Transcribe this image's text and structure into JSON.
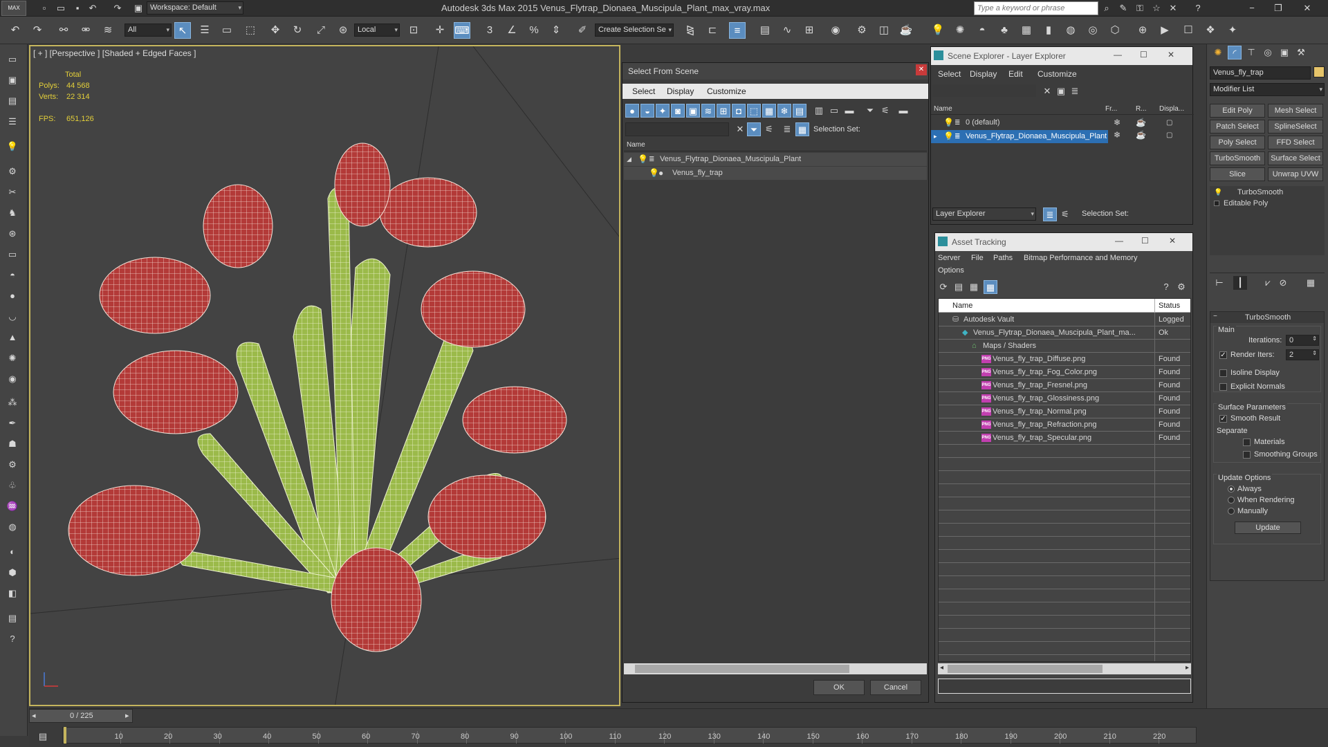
{
  "app": {
    "workspace_label": "Workspace: Default",
    "title": "Autodesk 3ds Max  2015     Venus_Flytrap_Dionaea_Muscipula_Plant_max_vray.max",
    "search_placeholder": "Type a keyword or phrase",
    "logo": "MAX"
  },
  "toolbar": {
    "filter": "All",
    "coord_system": "Local",
    "selection_set": "Create Selection Se"
  },
  "viewport": {
    "label": "[ + ] [Perspective ] [Shaded + Edged Faces ]",
    "stats": {
      "total_label": "Total",
      "polys_label": "Polys:",
      "polys_value": "44 568",
      "verts_label": "Verts:",
      "verts_value": "22 314",
      "fps_label": "FPS:",
      "fps_value": "651,126"
    }
  },
  "timeline": {
    "frame_counter": "0 / 225",
    "ticks": [
      "10",
      "20",
      "30",
      "40",
      "50",
      "60",
      "70",
      "80",
      "90",
      "100",
      "110",
      "120",
      "130",
      "140",
      "150",
      "160",
      "170",
      "180",
      "190",
      "200",
      "210",
      "220"
    ]
  },
  "select_from_scene": {
    "title": "Select From Scene",
    "menu": [
      "Select",
      "Display",
      "Customize"
    ],
    "selection_set_label": "Selection Set:",
    "column_name": "Name",
    "tree": [
      {
        "label": "Venus_Flytrap_Dionaea_Muscipula_Plant",
        "level": 0
      },
      {
        "label": "Venus_fly_trap",
        "level": 1
      }
    ],
    "ok": "OK",
    "cancel": "Cancel"
  },
  "scene_explorer": {
    "title": "Scene Explorer - Layer Explorer",
    "menu": [
      "Select",
      "Display",
      "Edit",
      "Customize"
    ],
    "columns": [
      "Name",
      "Fr...",
      "R...",
      "Displa..."
    ],
    "rows": [
      "0 (default)",
      "Venus_Flytrap_Dionaea_Muscipula_Plant"
    ],
    "footer_dropdown": "Layer Explorer",
    "footer_label": "Selection Set:"
  },
  "asset_tracking": {
    "title": "Asset Tracking",
    "menu_row1": [
      "Server",
      "File",
      "Paths",
      "Bitmap Performance and Memory"
    ],
    "menu_row2": [
      "Options"
    ],
    "columns": [
      "Name",
      "Status"
    ],
    "rows": [
      {
        "name": "Autodesk Vault",
        "status": "Logged",
        "level": 0,
        "icon": "vault"
      },
      {
        "name": "Venus_Flytrap_Dionaea_Muscipula_Plant_ma...",
        "status": "Ok",
        "level": 1,
        "icon": "max"
      },
      {
        "name": "Maps / Shaders",
        "status": "",
        "level": 2,
        "icon": "folder"
      },
      {
        "name": "Venus_fly_trap_Diffuse.png",
        "status": "Found",
        "level": 3,
        "icon": "png"
      },
      {
        "name": "Venus_fly_trap_Fog_Color.png",
        "status": "Found",
        "level": 3,
        "icon": "png"
      },
      {
        "name": "Venus_fly_trap_Fresnel.png",
        "status": "Found",
        "level": 3,
        "icon": "png"
      },
      {
        "name": "Venus_fly_trap_Glossiness.png",
        "status": "Found",
        "level": 3,
        "icon": "png"
      },
      {
        "name": "Venus_fly_trap_Normal.png",
        "status": "Found",
        "level": 3,
        "icon": "png"
      },
      {
        "name": "Venus_fly_trap_Refraction.png",
        "status": "Found",
        "level": 3,
        "icon": "png"
      },
      {
        "name": "Venus_fly_trap_Specular.png",
        "status": "Found",
        "level": 3,
        "icon": "png"
      }
    ]
  },
  "command_panel": {
    "object_name": "Venus_fly_trap",
    "modifier_list": "Modifier List",
    "modifier_buttons": [
      "Edit Poly",
      "Mesh Select",
      "Patch Select",
      "SplineSelect",
      "Poly Select",
      "FFD Select",
      "TurboSmooth",
      "Surface Select",
      "Slice",
      "Unwrap UVW"
    ],
    "stack": [
      "TurboSmooth",
      "Editable Poly"
    ],
    "rollout_title": "TurboSmooth",
    "main_label": "Main",
    "iterations_label": "Iterations:",
    "iterations_value": "0",
    "render_iters_label": "Render Iters:",
    "render_iters_value": "2",
    "isoline_label": "Isoline Display",
    "explicit_normals_label": "Explicit Normals",
    "surface_params_label": "Surface Parameters",
    "smooth_result_label": "Smooth Result",
    "separate_label": "Separate",
    "materials_label": "Materials",
    "smoothing_groups_label": "Smoothing Groups",
    "update_options_label": "Update Options",
    "always_label": "Always",
    "when_rendering_label": "When Rendering",
    "manually_label": "Manually",
    "update_button": "Update"
  },
  "colors": {
    "accent": "#2c6fb3",
    "viewport_border": "#c5b55d",
    "stats_yellow": "#e3cf3a"
  }
}
